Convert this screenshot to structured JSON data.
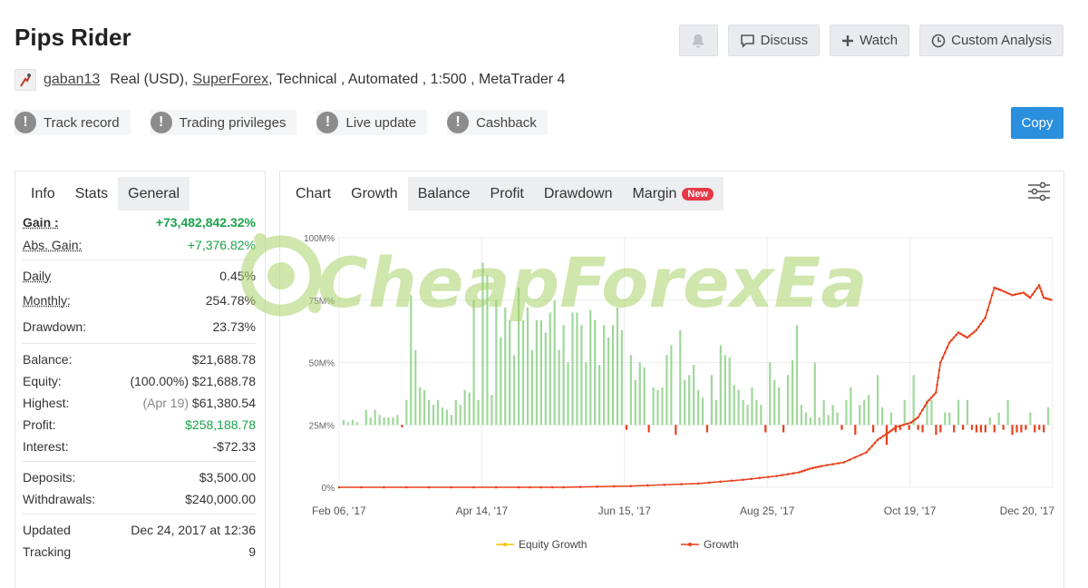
{
  "title": "Pips Rider",
  "actions": {
    "discuss": "Discuss",
    "watch": "Watch",
    "custom_analysis": "Custom Analysis",
    "copy": "Copy"
  },
  "account": {
    "user": "gaban13",
    "type": "Real (USD),",
    "broker": "SuperForex",
    "details": ", Technical , Automated , 1:500 , MetaTrader 4"
  },
  "badges": [
    "Track record",
    "Trading privileges",
    "Live update",
    "Cashback"
  ],
  "info_tabs": [
    "Info",
    "Stats",
    "General"
  ],
  "stats": {
    "gain": {
      "label": "Gain :",
      "value": "+73,482,842.32%"
    },
    "abs_gain": {
      "label": "Abs. Gain:",
      "value": "+7,376.82%"
    },
    "daily": {
      "label": "Daily",
      "value": "0.45%"
    },
    "monthly": {
      "label": "Monthly:",
      "value": "254.78%"
    },
    "drawdown": {
      "label": "Drawdown:",
      "value": "23.73%"
    },
    "balance": {
      "label": "Balance:",
      "value": "$21,688.78"
    },
    "equity": {
      "label": "Equity:",
      "value": "(100.00%) $21,688.78"
    },
    "highest": {
      "label": "Highest:",
      "date": "(Apr 19)",
      "value": "$61,380.54"
    },
    "profit": {
      "label": "Profit:",
      "value": "$258,188.78"
    },
    "interest": {
      "label": "Interest:",
      "value": "-$72.33"
    },
    "deposits": {
      "label": "Deposits:",
      "value": "$3,500.00"
    },
    "withdrawals": {
      "label": "Withdrawals:",
      "value": "$240,000.00"
    },
    "updated": {
      "label": "Updated",
      "value": "Dec 24, 2017 at 12:36"
    },
    "tracking": {
      "label": "Tracking",
      "value": "9"
    }
  },
  "chart_tabs": {
    "label": "Chart",
    "items": [
      "Growth",
      "Balance",
      "Profit",
      "Drawdown",
      "Margin"
    ],
    "new_badge": "New"
  },
  "watermark": "CheapForexEa",
  "colors": {
    "growth": "#e8401c",
    "equity": "#f2c300",
    "bar_pos": "#9fd89a",
    "bar_neg": "#e8401c",
    "accent": "#2a8fdd"
  },
  "chart_data": {
    "type": "line",
    "y_tick_labels": [
      "0%",
      "25M%",
      "50M%",
      "75M%",
      "100M%"
    ],
    "ylim": [
      0,
      100
    ],
    "x_tick_labels": [
      "Feb 06, '17",
      "Apr 14, '17",
      "Jun 15, '17",
      "Aug 25, '17",
      "Oct 19, '17",
      "Dec 20, '17"
    ],
    "x_range_days": [
      0,
      318
    ],
    "series": [
      {
        "name": "Equity Growth",
        "x": [],
        "values": []
      },
      {
        "name": "Growth",
        "x": [
          0,
          40,
          80,
          100,
          130,
          160,
          180,
          195,
          205,
          210,
          215,
          225,
          235,
          240,
          245,
          248,
          255,
          258,
          262,
          266,
          268,
          272,
          276,
          280,
          284,
          288,
          292,
          295,
          300,
          305,
          308,
          312,
          314,
          318
        ],
        "values": [
          0,
          0,
          0,
          0,
          0.5,
          1.5,
          3,
          4.5,
          6,
          7.5,
          8.5,
          10,
          14,
          19,
          22,
          24,
          26,
          28,
          34,
          38,
          50,
          58,
          62,
          60,
          63,
          68,
          80,
          79,
          77,
          78,
          76,
          81,
          76,
          75
        ]
      }
    ],
    "bars": {
      "name": "Daily growth",
      "x": [
        2,
        4,
        6,
        8,
        12,
        14,
        16,
        18,
        20,
        22,
        24,
        26,
        28,
        30,
        32,
        34,
        36,
        38,
        40,
        42,
        44,
        46,
        48,
        50,
        52,
        54,
        56,
        58,
        60,
        62,
        64,
        66,
        68,
        70,
        72,
        74,
        76,
        78,
        80,
        82,
        84,
        86,
        88,
        90,
        92,
        94,
        96,
        98,
        100,
        102,
        104,
        106,
        108,
        110,
        112,
        114,
        116,
        118,
        120,
        122,
        124,
        126,
        128,
        130,
        132,
        134,
        136,
        138,
        140,
        142,
        144,
        146,
        148,
        150,
        152,
        154,
        156,
        158,
        160,
        162,
        164,
        166,
        168,
        170,
        172,
        174,
        176,
        178,
        180,
        182,
        184,
        186,
        188,
        190,
        192,
        194,
        196,
        198,
        200,
        202,
        204,
        206,
        208,
        210,
        212,
        214,
        216,
        218,
        220,
        222,
        224,
        226,
        228,
        230,
        232,
        234,
        236,
        238,
        240,
        242,
        244,
        246,
        248,
        250,
        252,
        254,
        256,
        258,
        260,
        262,
        264,
        266,
        268,
        270,
        272,
        274,
        276,
        278,
        280,
        282,
        284,
        286,
        288,
        290,
        292,
        294,
        296,
        298,
        300,
        302,
        304,
        306,
        308,
        310,
        312,
        314,
        316
      ],
      "values": [
        2,
        1,
        2,
        1,
        6,
        3,
        6,
        4,
        3,
        3,
        3,
        4,
        -1,
        10,
        52,
        30,
        15,
        14,
        10,
        8,
        10,
        7,
        6,
        4,
        10,
        8,
        14,
        13,
        50,
        10,
        65,
        60,
        12,
        50,
        35,
        47,
        42,
        28,
        55,
        42,
        47,
        30,
        42,
        42,
        37,
        45,
        50,
        30,
        40,
        25,
        45,
        45,
        40,
        25,
        46,
        42,
        24,
        40,
        35,
        40,
        47,
        38,
        -2,
        28,
        18,
        25,
        23,
        -3,
        15,
        14,
        15,
        28,
        32,
        -4,
        38,
        18,
        20,
        24,
        14,
        11,
        -3,
        20,
        10,
        32,
        28,
        27,
        16,
        14,
        10,
        8,
        15,
        10,
        8,
        -3,
        25,
        18,
        15,
        -3,
        20,
        26,
        40,
        8,
        5,
        3,
        25,
        3,
        10,
        4,
        8,
        5,
        -2,
        10,
        15,
        -4,
        8,
        10,
        12,
        -3,
        20,
        7,
        -8,
        5,
        -3,
        -2,
        10,
        -2,
        20,
        -2,
        -3,
        10,
        10,
        -4,
        -3,
        5,
        5,
        -3,
        10,
        -2,
        10,
        -2,
        -3,
        -3,
        -3,
        3,
        -3,
        5,
        -2,
        10,
        -4,
        -3,
        -3,
        -2,
        5,
        -3,
        -2,
        -3,
        7,
        -12,
        -3,
        -3
      ]
    },
    "legend_position": "bottom-center"
  }
}
